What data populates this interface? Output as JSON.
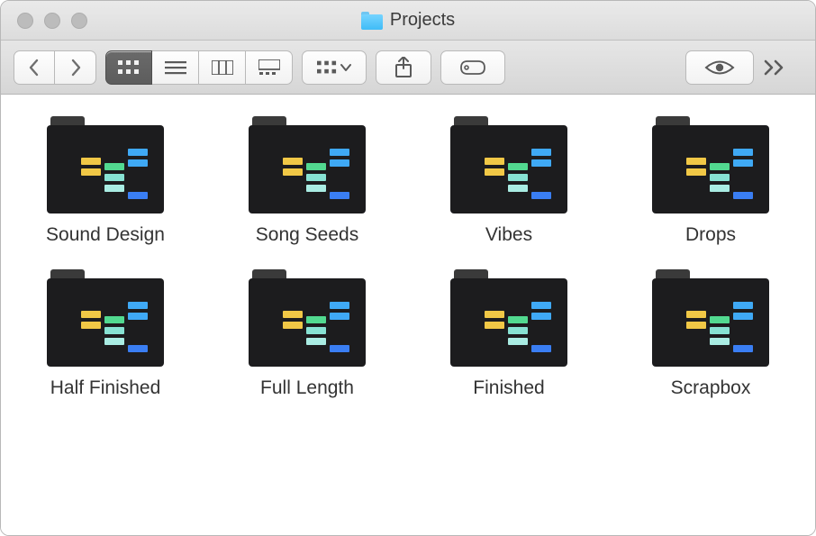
{
  "window": {
    "title": "Projects"
  },
  "folders": [
    {
      "label": "Sound Design"
    },
    {
      "label": "Song Seeds"
    },
    {
      "label": "Vibes"
    },
    {
      "label": "Drops"
    },
    {
      "label": "Half Finished"
    },
    {
      "label": "Full Length"
    },
    {
      "label": "Finished"
    },
    {
      "label": "Scrapbox"
    }
  ],
  "icons": {
    "back": "←",
    "forward": "→",
    "icon_view": "grid",
    "list_view": "list",
    "column_view": "columns",
    "gallery_view": "gallery",
    "arrange": "arrange",
    "share": "share",
    "tags": "tag",
    "quicklook": "eye",
    "overflow": "»"
  }
}
